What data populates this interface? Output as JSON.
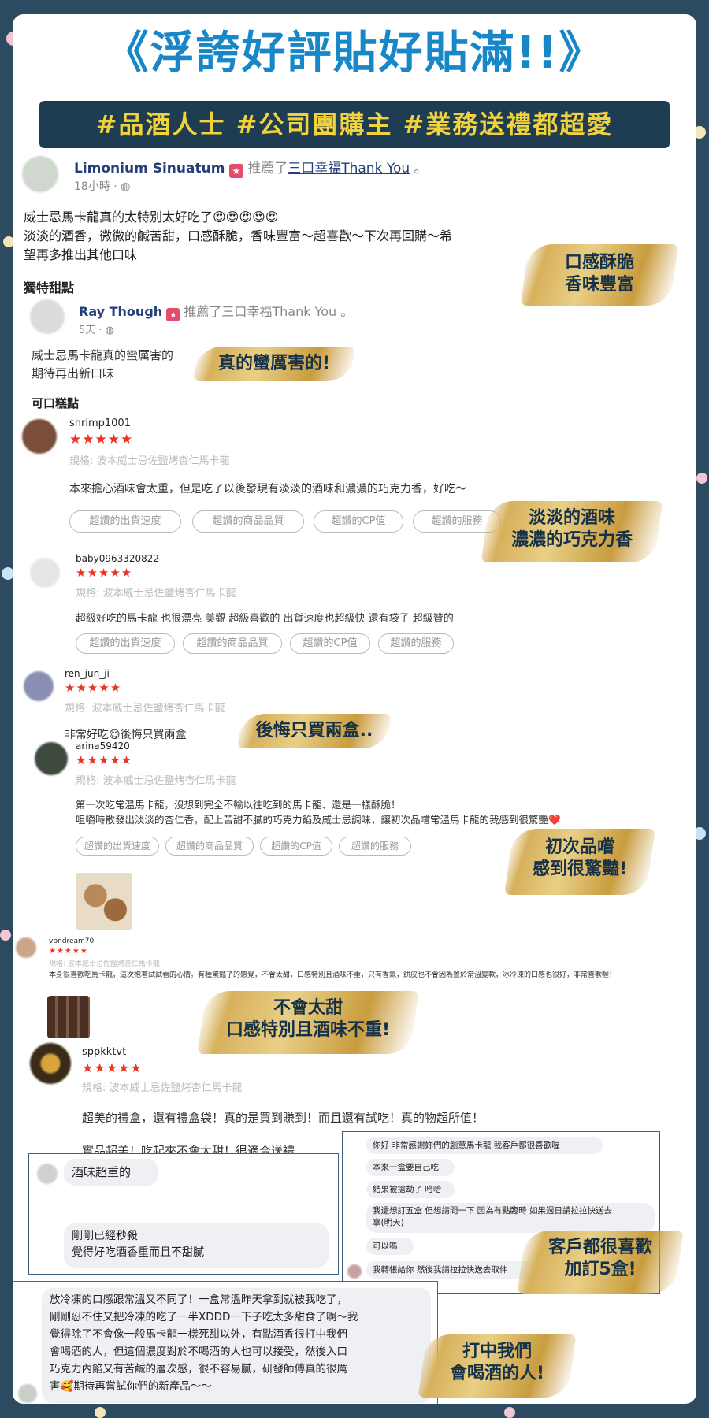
{
  "header": {
    "title": "《浮誇好評貼好貼滿!!》",
    "tags": "#品酒人士 #公司團購主 #業務送禮都超愛"
  },
  "post1": {
    "user": "Limonium Sinuatum",
    "action": "推薦了",
    "target": "三口幸福Thank You",
    "suffix": "。",
    "time": "18小時 · ",
    "text1": "威士忌馬卡龍真的太特別太好吃了😍😍😍😍😍",
    "text2": "淡淡的酒香，微微的鹹苦甜，口感酥脆，香味豐富～超喜歡～下次再回購～希",
    "text3": "望再多推出其他口味"
  },
  "section1": "獨特甜點",
  "post2": {
    "user": "Ray Though",
    "action": "推薦了三口幸福Thank You",
    "suffix": "。",
    "time": "5天 · ",
    "text1": "威士忌馬卡龍真的蠻厲害的",
    "text2": "期待再出新口味"
  },
  "section2": "可口糕點",
  "reviews": [
    {
      "user": "shrimp1001",
      "stars": "★★★★★",
      "spec": "規格: 波本威士忌佐鹽烤杏仁馬卡龍",
      "text": "本來擔心酒味會太重，但是吃了以後發現有淡淡的酒味和濃濃的巧克力香，好吃～"
    },
    {
      "user": "baby0963320822",
      "stars": "★★★★★",
      "spec": "規格: 波本威士忌佐鹽烤杏仁馬卡龍",
      "text": "超級好吃的馬卡龍 也很漂亮 美觀 超級喜歡的 出貨速度也超級快 還有袋子 超級贊的"
    },
    {
      "user": "ren_jun_ji",
      "stars": "★★★★★",
      "spec": "規格: 波本威士忌佐鹽烤杏仁馬卡龍",
      "text": "非常好吃😋後悔只買兩盒"
    },
    {
      "user": "arina59420",
      "stars": "★★★★★",
      "spec": "規格: 波本威士忌佐鹽烤杏仁馬卡龍",
      "text1": "第一次吃常溫馬卡龍，沒想到完全不輸以往吃到的馬卡龍、還是一樣酥脆！",
      "text2": "咀嚼時散發出淡淡的杏仁香，配上苦甜不膩的巧克力餡及威士忌調味，讓初次品嚐常溫馬卡龍的我感到很驚艷❤️"
    },
    {
      "user": "vbndream70",
      "stars": "★★★★★",
      "spec": "規格: 波本威士忌佐鹽烤杏仁馬卡龍",
      "text": "本身很喜歡吃馬卡龍，這次抱著試試看的心情。有種驚豔了的感覺，不會太甜，口感特別且酒味不重，只有香氣，餅皮也不會因為置於常溫變軟，冰冷凍的口感也很好，非常喜歡喔！"
    },
    {
      "user": "sppkktvt",
      "stars": "★★★★★",
      "spec": "規格: 波本威士忌佐鹽烤杏仁馬卡龍",
      "text1": "超美的禮盒，還有禮盒袋！真的是買到賺到！而且還有試吃！真的物超所值！",
      "text2": "實品超美！吃起來不會太甜！很適合送禮"
    }
  ],
  "pills": [
    "超讚的出貨速度",
    "超讚的商品品質",
    "超讚的CP值",
    "超讚的服務"
  ],
  "chat_left": {
    "msg1": "酒味超重的",
    "msg2a": "剛剛已經秒殺",
    "msg2b": "覺得好吃酒香重而且不甜膩"
  },
  "chat_right": [
    "你好 非常感謝妳們的創意馬卡龍 我客戶都很喜歡喔",
    "本來一盒要自己吃",
    "結果被搶劫了 哈哈",
    "我還想訂五盒 但想請問一下 因為有點臨時 如果週日請拉拉快送去",
    "拿(明天)",
    "可以嗎",
    "我轉帳給你 然後我請拉拉快送去取件"
  ],
  "bottom_post": {
    "lines": [
      "放冷凍的口感跟常溫又不同了！一盒常溫昨天拿到就被我吃了，",
      "剛剛忍不住又把冷凍的吃了一半XDDD一下子吃太多甜食了啊～我",
      "覺得除了不會像一般馬卡龍一樣死甜以外，有點酒香很打中我們",
      "會喝酒的人，但這個濃度對於不喝酒的人也可以接受，然後入口",
      "巧克力內餡又有苦鹹的層次感，很不容易膩，研發師傅真的很厲",
      "害🥰期待再嘗試你們的新產品～～"
    ]
  },
  "badges": {
    "b1a": "口感酥脆",
    "b1b": "香味豐富",
    "b2": "真的蠻厲害的!",
    "b3a": "淡淡的酒味",
    "b3b": "濃濃的巧克力香",
    "b4": "後悔只買兩盒..",
    "b5a": "初次品嚐",
    "b5b": "感到很驚豔!",
    "b6a": "不會太甜",
    "b6b": "口感特別且酒味不重!",
    "b7a": "客戶都很喜歡",
    "b7b": "加訂5盒!",
    "b8a": "打中我們",
    "b8b": "會喝酒的人!"
  }
}
